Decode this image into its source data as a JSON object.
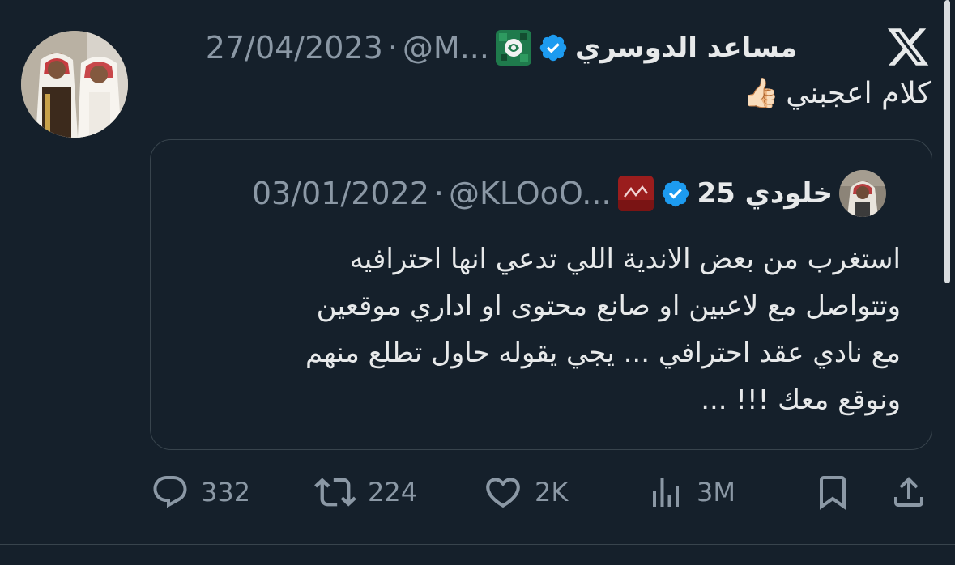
{
  "tweet": {
    "author": {
      "display_name": "مساعد الدوسري",
      "handle": "@M...",
      "verified": true,
      "avatar": "profile-photo"
    },
    "separator": "·",
    "date": "27/04/2023",
    "text": "كلام اعجبني",
    "emoji": "👍🏻"
  },
  "quoted_tweet": {
    "author": {
      "display_name": "خلودي 25",
      "handle": "@KLOoO...",
      "verified": true,
      "avatar": "profile-photo"
    },
    "separator": "·",
    "date": "03/01/2022",
    "lines": [
      "استغرب من بعض الاندية اللي تدعي انها احترافيه",
      "وتتواصل مع لاعبين او صانع محتوى او اداري موقعين",
      "مع نادي عقد احترافي ... يجي يقوله حاول تطلع منهم",
      "ونوقع معك  !!! ..."
    ]
  },
  "actions": {
    "replies": "332",
    "reposts": "224",
    "likes": "2K",
    "views": "3M"
  },
  "icons": {
    "brand": "x-logo",
    "reply": "reply-icon",
    "repost": "repost-icon",
    "like": "heart-icon",
    "views": "views-icon",
    "bookmark": "bookmark-icon",
    "share": "share-icon",
    "verified": "verified-badge-icon"
  },
  "colors": {
    "background": "#15202b",
    "text": "#e7e9ea",
    "muted": "#8b98a5",
    "verified": "#1d9bf0",
    "border": "#38444d"
  }
}
